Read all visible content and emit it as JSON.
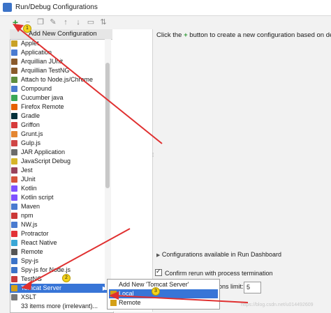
{
  "window": {
    "title": "Run/Debug Configurations"
  },
  "toolbar": {
    "icons": [
      "add-icon",
      "remove-icon",
      "copy-icon",
      "wrench-icon",
      "move-up-icon",
      "move-down-icon",
      "folder-icon",
      "sort-icon"
    ]
  },
  "popup": {
    "header": "Add New Configuration"
  },
  "list": {
    "items": [
      {
        "label": "Applet",
        "icon": "applet-icon",
        "color": "#c9a227"
      },
      {
        "label": "Application",
        "icon": "application-icon",
        "color": "#4a7bd0"
      },
      {
        "label": "Arquillian JUnit",
        "icon": "arquillian-icon",
        "color": "#8a5a2b"
      },
      {
        "label": "Arquillian TestNG",
        "icon": "arquillian-icon",
        "color": "#8a5a2b"
      },
      {
        "label": "Attach to Node.js/Chrome",
        "icon": "attach-icon",
        "color": "#5e8e3e"
      },
      {
        "label": "Compound",
        "icon": "compound-icon",
        "color": "#4a7bd0"
      },
      {
        "label": "Cucumber java",
        "icon": "cucumber-icon",
        "color": "#3aa757"
      },
      {
        "label": "Firefox Remote",
        "icon": "firefox-icon",
        "color": "#e66000"
      },
      {
        "label": "Gradle",
        "icon": "gradle-icon",
        "color": "#02303a"
      },
      {
        "label": "Griffon",
        "icon": "griffon-icon",
        "color": "#d63b3b"
      },
      {
        "label": "Grunt.js",
        "icon": "grunt-icon",
        "color": "#e48632"
      },
      {
        "label": "Gulp.js",
        "icon": "gulp-icon",
        "color": "#cf4646"
      },
      {
        "label": "JAR Application",
        "icon": "jar-icon",
        "color": "#6b6b6b"
      },
      {
        "label": "JavaScript Debug",
        "icon": "js-debug-icon",
        "color": "#d6b52a"
      },
      {
        "label": "Jest",
        "icon": "jest-icon",
        "color": "#99425b"
      },
      {
        "label": "JUnit",
        "icon": "junit-icon",
        "color": "#d6543c"
      },
      {
        "label": "Kotlin",
        "icon": "kotlin-icon",
        "color": "#7f52ff"
      },
      {
        "label": "Kotlin script",
        "icon": "kotlin-script-icon",
        "color": "#7f52ff"
      },
      {
        "label": "Maven",
        "icon": "maven-icon",
        "color": "#4a7bd0"
      },
      {
        "label": "npm",
        "icon": "npm-icon",
        "color": "#cb3837"
      },
      {
        "label": "NW.js",
        "icon": "nwjs-icon",
        "color": "#4a7bd0"
      },
      {
        "label": "Protractor",
        "icon": "protractor-icon",
        "color": "#e23237"
      },
      {
        "label": "React Native",
        "icon": "react-icon",
        "color": "#3aa7d6"
      },
      {
        "label": "Remote",
        "icon": "remote-icon",
        "color": "#555555"
      },
      {
        "label": "Spy-js",
        "icon": "spyjs-icon",
        "color": "#3b73c8"
      },
      {
        "label": "Spy-js for Node.js",
        "icon": "spyjs-node-icon",
        "color": "#3b73c8"
      },
      {
        "label": "TestNG",
        "icon": "testng-icon",
        "color": "#c83b3b"
      },
      {
        "label": "Tomcat Server",
        "icon": "tomcat-icon",
        "color": "#d4a017",
        "selected": true
      },
      {
        "label": "XSLT",
        "icon": "xslt-icon",
        "color": "#777777"
      }
    ],
    "more": "33 items more (irrelevant)..."
  },
  "right": {
    "hint_before": "Click the",
    "hint_after": "button to create a new configuration based on defaul",
    "dashboard": "Configurations available in Run Dashboard",
    "confirm": "Confirm rerun with process termination",
    "limit_label": "ons limit:",
    "limit_value": "5"
  },
  "submenu": {
    "header": "Add New 'Tomcat Server' Configuration",
    "items": [
      {
        "label": "Local",
        "icon": "tomcat-local-icon",
        "selected": true
      },
      {
        "label": "Remote",
        "icon": "tomcat-remote-icon"
      }
    ]
  },
  "badges": [
    "1",
    "2",
    "3"
  ],
  "watermark": "https://blog.csdn.net/u014492609",
  "colors": {
    "selection": "#3875d7",
    "arrow": "#e03030",
    "add": "#2f9a37"
  }
}
